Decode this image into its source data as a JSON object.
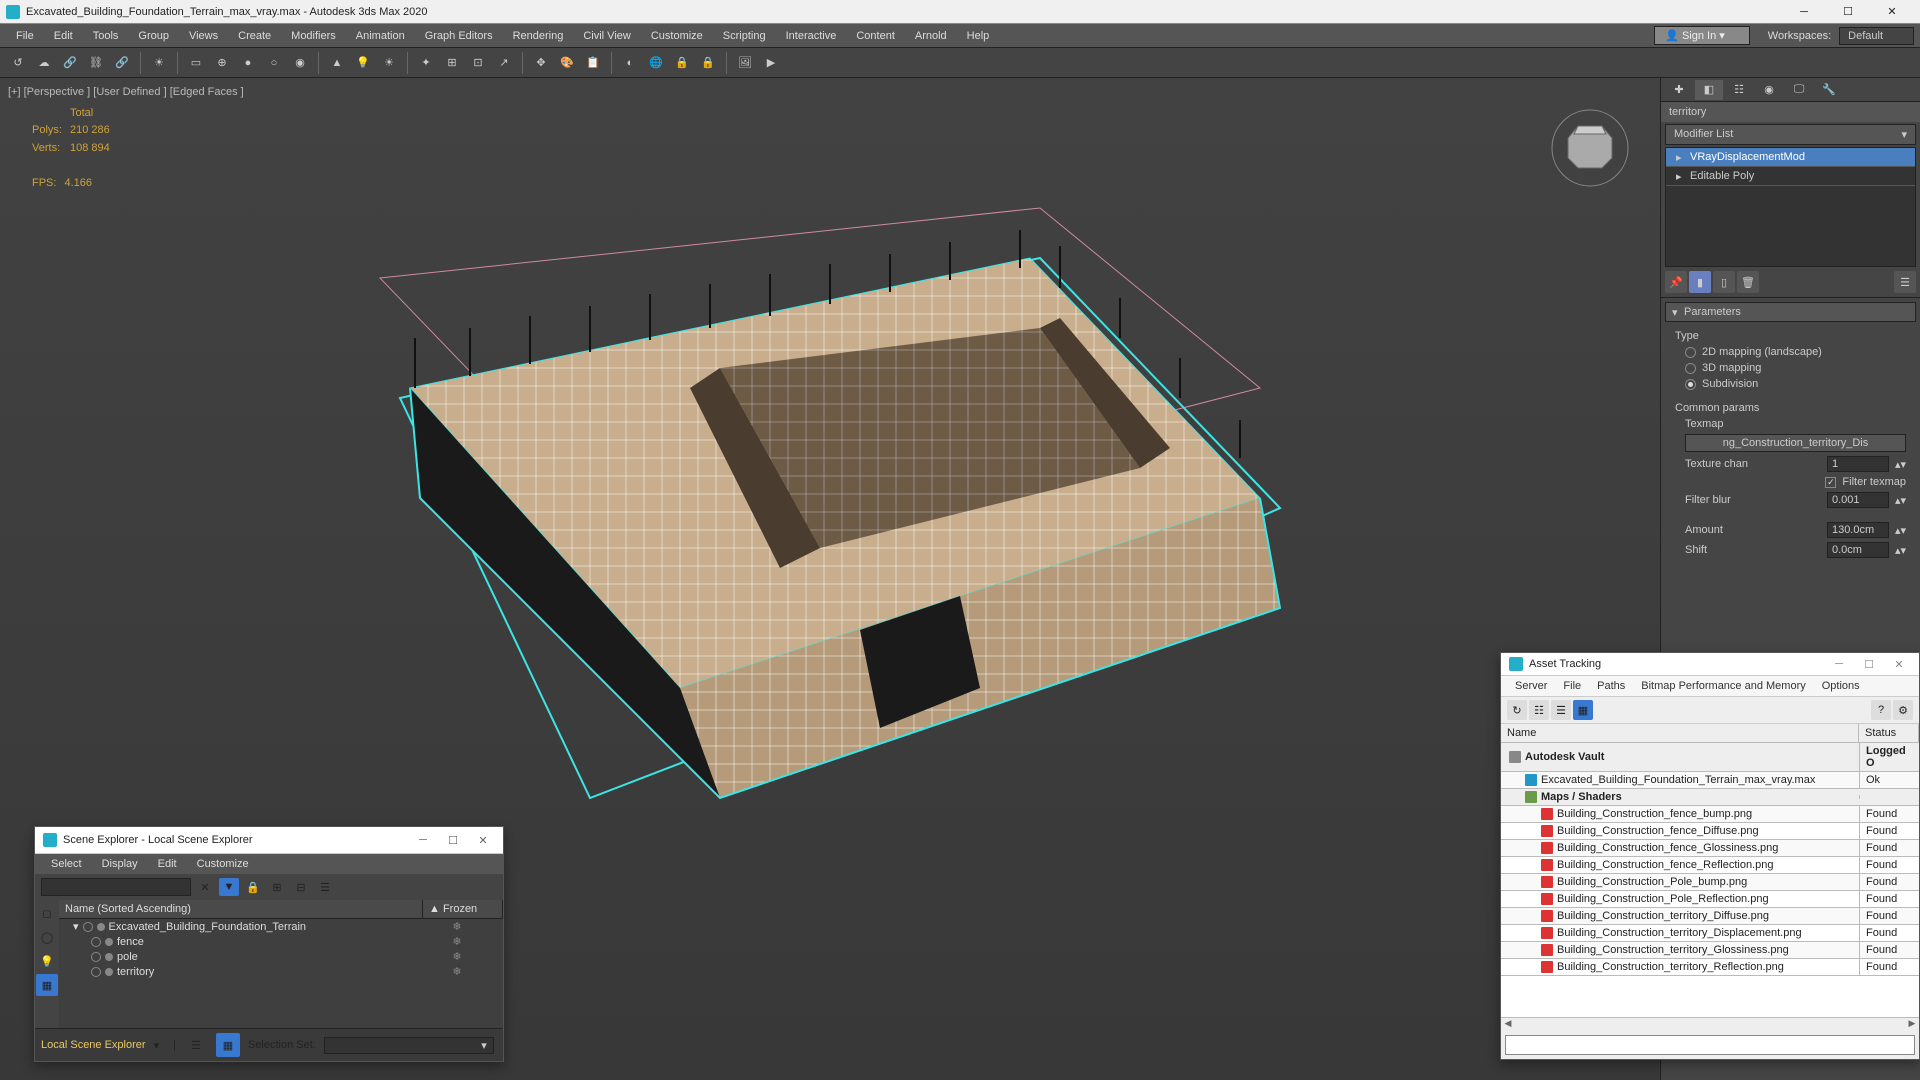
{
  "title": "Excavated_Building_Foundation_Terrain_max_vray.max - Autodesk 3ds Max 2020",
  "menus": [
    "File",
    "Edit",
    "Tools",
    "Group",
    "Views",
    "Create",
    "Modifiers",
    "Animation",
    "Graph Editors",
    "Rendering",
    "Civil View",
    "Customize",
    "Scripting",
    "Interactive",
    "Content",
    "Arnold",
    "Help"
  ],
  "sign_in": "Sign In",
  "workspaces_label": "Workspaces:",
  "workspace_value": "Default",
  "viewport": {
    "labels": "[+] [Perspective ] [User Defined ] [Edged Faces ]",
    "stats_header": "Total",
    "polys_label": "Polys:",
    "polys_value": "210 286",
    "verts_label": "Verts:",
    "verts_value": "108 894",
    "fps_label": "FPS:",
    "fps_value": "4.166"
  },
  "cmd": {
    "object_name": "territory",
    "modifier_list_label": "Modifier List",
    "stack": [
      "VRayDisplacementMod",
      "Editable Poly"
    ],
    "rollout_params": "Parameters",
    "type_label": "Type",
    "type_options": [
      "2D mapping (landscape)",
      "3D mapping",
      "Subdivision"
    ],
    "type_selected": 2,
    "common_label": "Common params",
    "texmap_label": "Texmap",
    "texmap_value": "ng_Construction_territory_Dis",
    "texture_chan_label": "Texture chan",
    "texture_chan_value": "1",
    "filter_texmap_label": "Filter texmap",
    "filter_blur_label": "Filter blur",
    "filter_blur_value": "0.001",
    "amount_label": "Amount",
    "amount_value": "130.0cm",
    "shift_label": "Shift",
    "shift_value": "0.0cm"
  },
  "scene_explorer": {
    "title": "Scene Explorer - Local Scene Explorer",
    "menus": [
      "Select",
      "Display",
      "Edit",
      "Customize"
    ],
    "col_name": "Name (Sorted Ascending)",
    "col_frozen": "▲ Frozen",
    "tree": [
      {
        "name": "Excavated_Building_Foundation_Terrain",
        "level": 0,
        "expand": "▾"
      },
      {
        "name": "fence",
        "level": 1
      },
      {
        "name": "pole",
        "level": 1
      },
      {
        "name": "territory",
        "level": 1
      }
    ],
    "status_label": "Local Scene Explorer",
    "selection_set_label": "Selection Set:"
  },
  "asset_tracking": {
    "title": "Asset Tracking",
    "menus": [
      "Server",
      "File",
      "Paths",
      "Bitmap Performance and Memory",
      "Options"
    ],
    "col_name": "Name",
    "col_status": "Status",
    "rows": [
      {
        "name": "Autodesk Vault",
        "status": "Logged O",
        "ico": "vault",
        "indent": 8,
        "hdr": true
      },
      {
        "name": "Excavated_Building_Foundation_Terrain_max_vray.max",
        "status": "Ok",
        "ico": "max",
        "indent": 24
      },
      {
        "name": "Maps / Shaders",
        "status": "",
        "ico": "folder",
        "indent": 24,
        "hdr": true
      },
      {
        "name": "Building_Construction_fence_bump.png",
        "status": "Found",
        "ico": "png",
        "indent": 40
      },
      {
        "name": "Building_Construction_fence_Diffuse.png",
        "status": "Found",
        "ico": "png",
        "indent": 40
      },
      {
        "name": "Building_Construction_fence_Glossiness.png",
        "status": "Found",
        "ico": "png",
        "indent": 40
      },
      {
        "name": "Building_Construction_fence_Reflection.png",
        "status": "Found",
        "ico": "png",
        "indent": 40
      },
      {
        "name": "Building_Construction_Pole_bump.png",
        "status": "Found",
        "ico": "png",
        "indent": 40
      },
      {
        "name": "Building_Construction_Pole_Reflection.png",
        "status": "Found",
        "ico": "png",
        "indent": 40
      },
      {
        "name": "Building_Construction_territory_Diffuse.png",
        "status": "Found",
        "ico": "png",
        "indent": 40
      },
      {
        "name": "Building_Construction_territory_Displacement.png",
        "status": "Found",
        "ico": "png",
        "indent": 40
      },
      {
        "name": "Building_Construction_territory_Glossiness.png",
        "status": "Found",
        "ico": "png",
        "indent": 40
      },
      {
        "name": "Building_Construction_territory_Reflection.png",
        "status": "Found",
        "ico": "png",
        "indent": 40
      }
    ]
  }
}
